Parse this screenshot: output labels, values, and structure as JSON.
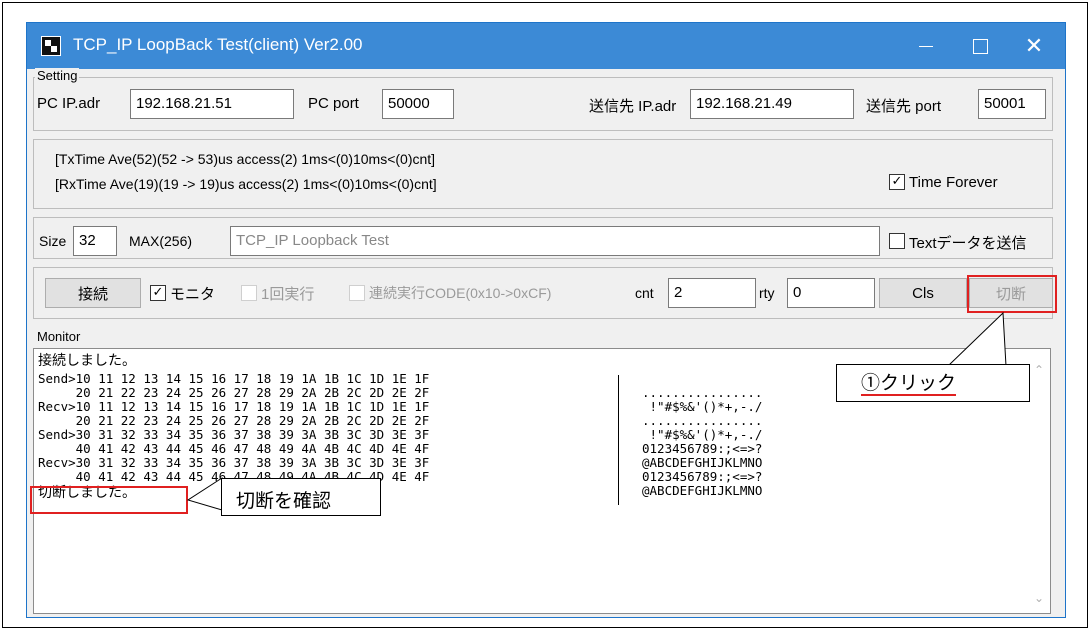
{
  "window": {
    "title": "TCP_IP LoopBack Test(client) Ver2.00",
    "buttons": {
      "minimize": "minimize",
      "maximize": "maximize",
      "close": "✕"
    }
  },
  "setting": {
    "group_label": "Setting",
    "pc_ip_label": "PC IP.adr",
    "pc_ip_value": "192.168.21.51",
    "pc_port_label": "PC port",
    "pc_port_value": "50000",
    "dest_ip_label": "送信先 IP.adr",
    "dest_ip_value": "192.168.21.49",
    "dest_port_label": "送信先 port",
    "dest_port_value": "50001"
  },
  "timing": {
    "tx_line": "[TxTime Ave(52)(52 -> 53)us access(2) 1ms<(0)10ms<(0)cnt]",
    "rx_line": "[RxTime Ave(19)(19 -> 19)us access(2) 1ms<(0)10ms<(0)cnt]",
    "time_forever_label": "Time Forever",
    "time_forever_checked": true
  },
  "data_row": {
    "size_label": "Size",
    "size_value": "32",
    "max_label": "MAX(256)",
    "text_value": "TCP_IP Loopback Test",
    "send_text_label": "Textデータを送信",
    "send_text_checked": false
  },
  "controls": {
    "connect_label": "接続",
    "monitor_label": "モニタ",
    "monitor_checked": true,
    "once_label": "1回実行",
    "continuous_label": "連続実行CODE(0x10->0xCF)",
    "cnt_label": "cnt",
    "cnt_value": "2",
    "rty_label": "rty",
    "rty_value": "0",
    "cls_label": "Cls",
    "disconnect_label": "切断"
  },
  "monitor": {
    "group_label": "Monitor",
    "lines": [
      "接続しました。",
      "Send>10 11 12 13 14 15 16 17 18 19 1A 1B 1C 1D 1E 1F",
      "     20 21 22 23 24 25 26 27 28 29 2A 2B 2C 2D 2E 2F",
      "Recv>10 11 12 13 14 15 16 17 18 19 1A 1B 1C 1D 1E 1F",
      "     20 21 22 23 24 25 26 27 28 29 2A 2B 2C 2D 2E 2F",
      "Send>30 31 32 33 34 35 36 37 38 39 3A 3B 3C 3D 3E 3F",
      "     40 41 42 43 44 45 46 47 48 49 4A 4B 4C 4D 4E 4F",
      "Recv>30 31 32 33 34 35 36 37 38 39 3A 3B 3C 3D 3E 3F",
      "     40 41 42 43 44 45 46 47 48 49 4A 4B 4C 4D 4E 4F",
      "切断しました。"
    ],
    "ascii": [
      "................",
      " !\"#$%&'()*+,-./",
      "................",
      " !\"#$%&'()*+,-./",
      "0123456789:;<=>?",
      "@ABCDEFGHIJKLMNO",
      "0123456789:;<=>?",
      "@ABCDEFGHIJKLMNO"
    ]
  },
  "annotations": {
    "click_callout": "①クリック",
    "confirm_callout": "切断を確認"
  },
  "colors": {
    "titlebar": "#3c8ad6",
    "highlight_red": "#e02020"
  }
}
